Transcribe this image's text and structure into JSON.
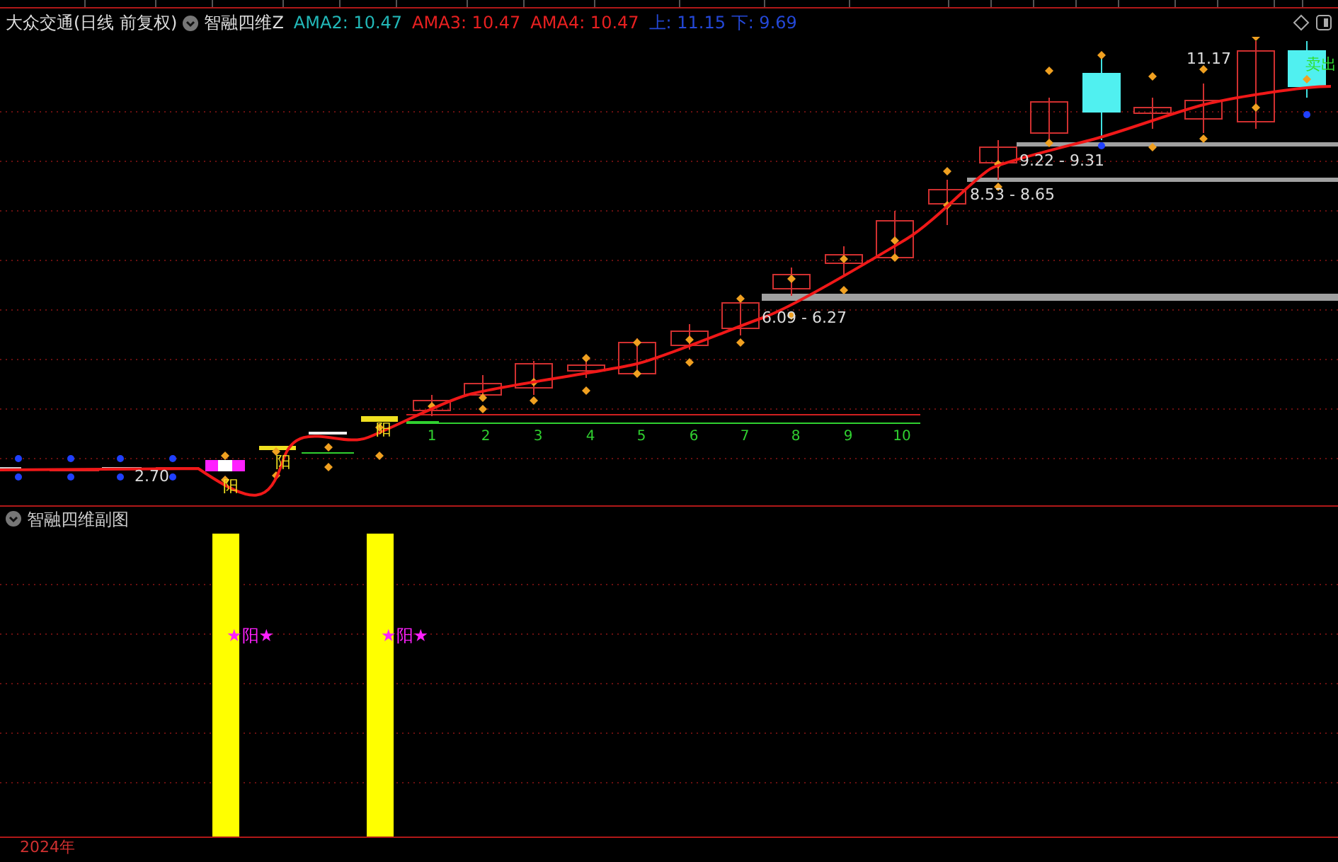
{
  "header": {
    "title": "大众交通(日线 前复权)",
    "indicator": "智融四维Z",
    "values": [
      {
        "label": "AMA2: 10.47",
        "color": "#22b8b8"
      },
      {
        "label": "AMA3: 10.47",
        "color": "#e82020"
      },
      {
        "label": "AMA4: 10.47",
        "color": "#e82020"
      },
      {
        "label": "上: 11.15 下: 9.69",
        "color": "#2448d8"
      }
    ]
  },
  "main_chart": {
    "price_labels": [
      "2.70",
      "6.09 - 6.27",
      "8.53 - 8.65",
      "9.22 - 9.31",
      "11.17"
    ],
    "count_labels": [
      "1",
      "2",
      "3",
      "4",
      "5",
      "6",
      "7",
      "8",
      "9",
      "10"
    ],
    "yang_marks": [
      "阳",
      "阳",
      "阳"
    ],
    "sell_mark": "卖出"
  },
  "sub_chart": {
    "title": "智融四维副图",
    "marks": [
      "★阳★",
      "★阳★"
    ]
  },
  "footer": {
    "year": "2024年"
  }
}
